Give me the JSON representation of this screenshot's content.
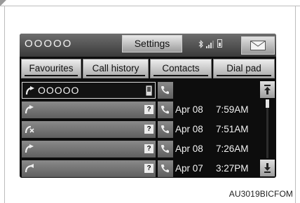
{
  "header": {
    "device_name": "OOOOO",
    "settings_label": "Settings",
    "status_icons": [
      "bluetooth-icon",
      "signal-icon",
      "battery-icon"
    ],
    "mail_icon": "envelope-icon"
  },
  "tabs": [
    {
      "label": "Favourites",
      "active": false
    },
    {
      "label": "Call history",
      "active": false
    },
    {
      "label": "Contacts",
      "active": false
    },
    {
      "label": "Dial pad",
      "active": false
    }
  ],
  "call_list": [
    {
      "type": "outgoing",
      "name": "OOOOO",
      "number_type_icon": "mobile-phone-icon",
      "date": "",
      "time": ""
    },
    {
      "type": "outgoing",
      "name": "",
      "number_type_icon": "unknown-icon",
      "date": "Apr 08",
      "time": "7:59AM"
    },
    {
      "type": "missed",
      "name": "",
      "number_type_icon": "unknown-icon",
      "date": "Apr 08",
      "time": "7:51AM"
    },
    {
      "type": "outgoing",
      "name": "",
      "number_type_icon": "unknown-icon",
      "date": "Apr 08",
      "time": "7:26AM"
    },
    {
      "type": "incoming",
      "name": "",
      "number_type_icon": "unknown-icon",
      "date": "Apr 07",
      "time": "3:27PM"
    }
  ],
  "unknown_glyph": "?",
  "scroll": {
    "up_icon": "arrow-up-icon",
    "down_icon": "arrow-down-icon",
    "position": 0
  },
  "figure_code": "AU3019BICFOM",
  "colors": {
    "screen_bg": "#0d0d0d",
    "row_bg": "#6f6f6f",
    "text": "#f2f2f2"
  }
}
